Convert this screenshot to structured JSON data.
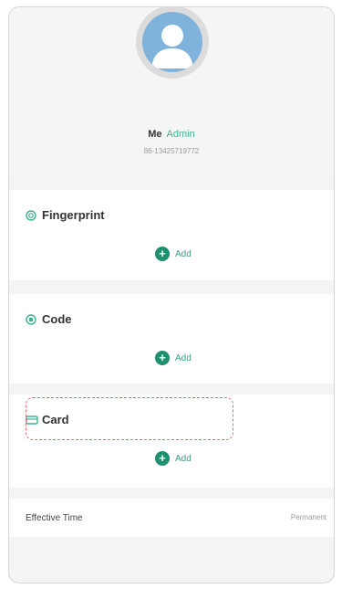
{
  "user": {
    "name": "Me",
    "role": "Admin",
    "phone": "86-13425719772"
  },
  "sections": {
    "fingerprint": {
      "title": "Fingerprint",
      "add_label": "Add",
      "icon": "fingerprint-icon"
    },
    "code": {
      "title": "Code",
      "add_label": "Add",
      "icon": "code-icon"
    },
    "card": {
      "title": "Card",
      "add_label": "Add",
      "icon": "card-icon"
    }
  },
  "effective_time": {
    "label": "Effective Time",
    "value": "Permanent"
  },
  "colors": {
    "accent": "#1f8f70",
    "role_text": "#3cb38f",
    "highlight_dash": "#e07070",
    "avatar": "#7fb3dc"
  }
}
